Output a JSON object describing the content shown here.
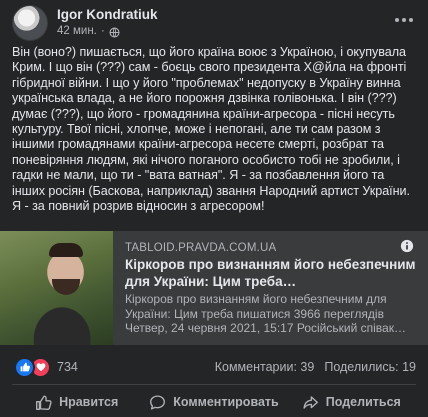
{
  "post": {
    "author": "Igor Kondratiuk",
    "time": "42 мин.",
    "separator": "·",
    "text": [
      "Він (воно?) пишається, що його країна воює з Україною, і окупувала Крим. І що він (???) сам - боєць свого президента Х@йла на фронті гібридної війни. І що у його \"проблемах\" недопуску в Україну винна українська влада, а не його порожня дзвінка голівонька. І він (???) думає (???), що його - громадянина країни-агресора - пісні несуть культуру. Твої пісні, хлопче, може і непогані, але ти сам разом з іншими громадянами країни-агресора несете смерті, розбрат та поневіряння людям, які нічого поганого особисто тобі не зробили, і гадки не мали, що ти - \"вата ватная\". Я - за позбавлення його та інших росіян (Баскова, наприклад) звання Народний артист України. Я - за повний розрив відносин з агресором!"
    ]
  },
  "link_preview": {
    "domain": "TABLOID.PRAVDA.COM.UA",
    "title": "Кіркоров про визнанням його небезпечним для України: Цим треба…",
    "description": "Кіркоров про визнанням його небезпечним для України: Цим треба пишатися 3966 переглядів Четвер, 24 червня 2021, 15:17 Російський співак…"
  },
  "stats": {
    "reaction_count": "734",
    "comments": "Комментарии: 39",
    "shares": "Поделились: 19"
  },
  "actions": {
    "like": "Нравится",
    "comment": "Комментировать",
    "share": "Поделиться"
  },
  "colors": {
    "background": "#242526",
    "card": "#3a3b3c",
    "text_primary": "#e4e6eb",
    "text_secondary": "#b0b3b8",
    "like_blue": "#1877f2",
    "love_red": "#f33e58"
  },
  "icons": {
    "privacy": "globe-icon",
    "menu": "more-horizontal-icon",
    "link_info": "info-icon",
    "reaction_like": "thumbs-up-icon",
    "reaction_love": "heart-icon",
    "action_like": "thumbs-up-outline-icon",
    "action_comment": "speech-bubble-icon",
    "action_share": "share-arrow-icon"
  }
}
